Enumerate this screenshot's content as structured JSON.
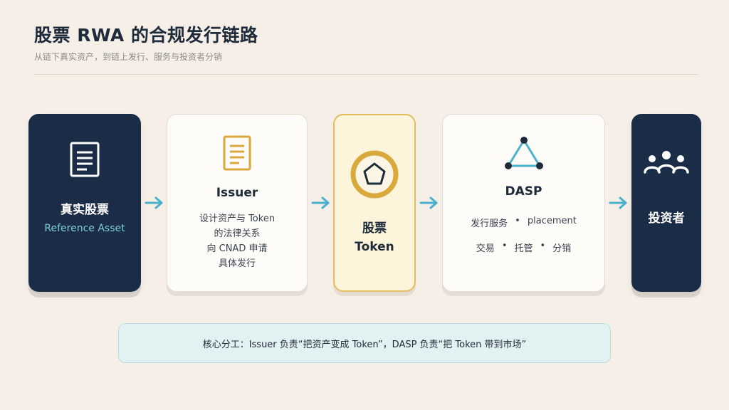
{
  "header": {
    "title": "股票 RWA 的合规发行链路",
    "subtitle": "从链下真实资产，到链上发行、服务与投资者分销"
  },
  "colors": {
    "dark_card": "#1b2c47",
    "gold": "#e3bd5c",
    "teal": "#4bb0cc",
    "note_bg": "#e2f1f2"
  },
  "cards": {
    "asset": {
      "icon": "document-icon",
      "title": "真实股票",
      "subtitle": "Reference Asset"
    },
    "issuer": {
      "icon": "document-icon",
      "title": "Issuer",
      "lines": [
        "设计资产与 Token",
        "的法律关系",
        "向 CNAD 申请",
        "具体发行"
      ]
    },
    "token": {
      "icon": "token-coin-icon",
      "line1": "股票",
      "line2": "Token"
    },
    "dasp": {
      "icon": "network-triangle-icon",
      "title": "DASP",
      "row1": [
        "发行服务",
        "placement"
      ],
      "row2": [
        "交易",
        "托管",
        "分销"
      ],
      "separator": "•"
    },
    "investor": {
      "icon": "people-group-icon",
      "title": "投资者"
    }
  },
  "note": "核心分工：Issuer 负责“把资产变成 Token”，DASP 负责“把 Token 带到市场”"
}
